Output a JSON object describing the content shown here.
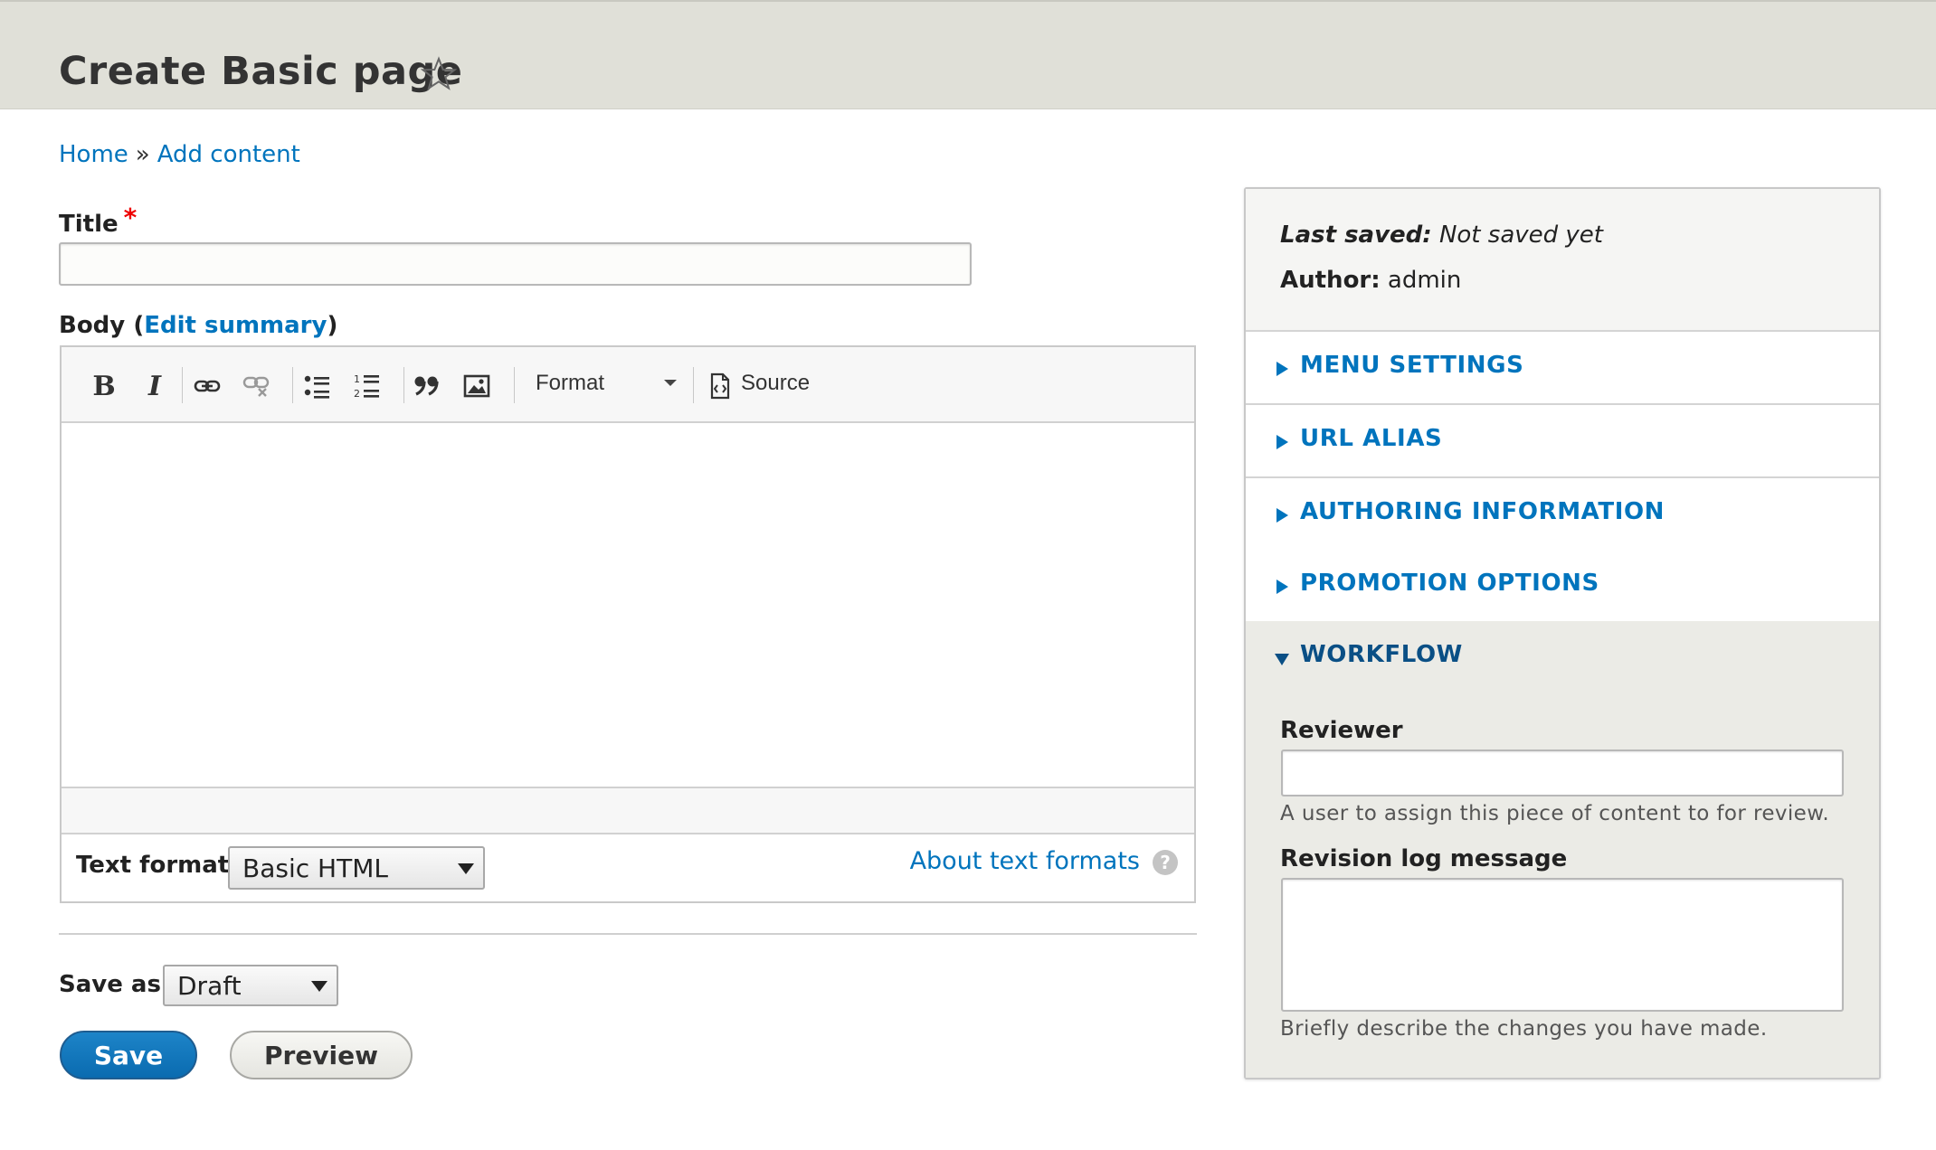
{
  "header": {
    "title": "Create Basic page",
    "star_icon": "star-outline-icon"
  },
  "breadcrumb": {
    "home": "Home",
    "separator": "»",
    "add_content": "Add content"
  },
  "form": {
    "title_label": "Title",
    "required_marker": "*",
    "title_value": "",
    "body_label": "Body",
    "body_open_paren": "(",
    "edit_summary": "Edit summary",
    "body_close_paren": ")",
    "toolbar": {
      "bold": "B",
      "italic": "I",
      "format_label": "Format",
      "source_label": "Source",
      "icons": [
        "bold-icon",
        "italic-icon",
        "link-icon",
        "unlink-icon",
        "bulleted-list-icon",
        "numbered-list-icon",
        "blockquote-icon",
        "image-icon",
        "source-icon"
      ]
    },
    "body_value": "",
    "text_format_label": "Text format",
    "text_format_value": "Basic HTML",
    "about_text_formats": "About text formats",
    "help_glyph": "?",
    "save_as_label": "Save as:",
    "save_as_value": "Draft",
    "save_button": "Save",
    "preview_button": "Preview"
  },
  "sidebar": {
    "last_saved_label": "Last saved:",
    "last_saved_value": "Not saved yet",
    "author_label": "Author:",
    "author_value": "admin",
    "sections": [
      {
        "label": "MENU SETTINGS",
        "expanded": false
      },
      {
        "label": "URL ALIAS",
        "expanded": false
      },
      {
        "label": "AUTHORING INFORMATION",
        "expanded": false
      },
      {
        "label": "PROMOTION OPTIONS",
        "expanded": false
      }
    ],
    "workflow": {
      "label": "WORKFLOW",
      "expanded": true,
      "reviewer_label": "Reviewer",
      "reviewer_value": "",
      "reviewer_description": "A user to assign this piece of content to for review.",
      "revision_label": "Revision log message",
      "revision_value": "",
      "revision_description": "Briefly describe the changes you have made."
    }
  },
  "colors": {
    "link": "#0074bd",
    "header_bg": "#e0e0d8",
    "primary_button": "#0a6bb0",
    "required": "#e00000"
  }
}
